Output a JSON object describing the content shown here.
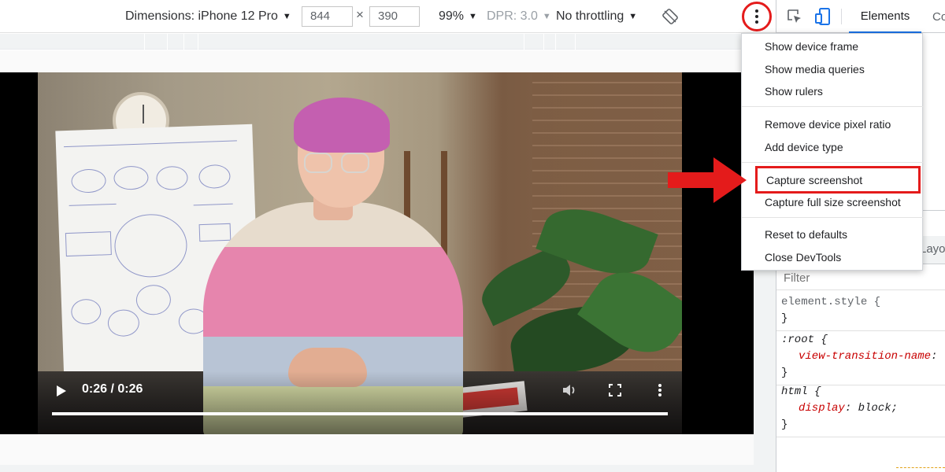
{
  "device_toolbar": {
    "dimensions_label": "Dimensions: iPhone 12 Pro",
    "width_value": "844",
    "height_value": "390",
    "times": "×",
    "zoom": "99%",
    "dpr": "DPR: 3.0",
    "throttling": "No throttling"
  },
  "video": {
    "time": "0:26 / 0:26",
    "progress": 1.0
  },
  "devtools": {
    "tab_elements": "Elements",
    "tab_console": "Co",
    "layout_tab": "Layou",
    "filter_placeholder": "Filter",
    "rules": [
      {
        "selector": "element.style {",
        "props": [],
        "close": "}"
      },
      {
        "selector": ":root {",
        "props": [
          {
            "name": "view-transition-name",
            "value": ":"
          }
        ],
        "close": "}"
      },
      {
        "selector": "html {",
        "props": [
          {
            "name": "display",
            "value": "block;"
          }
        ],
        "close": "}"
      }
    ]
  },
  "menu": {
    "items": [
      "Show device frame",
      "Show media queries",
      "Show rulers",
      "Remove device pixel ratio",
      "Add device type",
      "Capture screenshot",
      "Capture full size screenshot",
      "Reset to defaults",
      "Close DevTools"
    ]
  },
  "colors": {
    "annotation_red": "#e41b1b",
    "active_tab_underline": "#1a73e8",
    "css_property": "#c80000"
  },
  "icons": {
    "rotate": "rotate-icon",
    "more": "more-vertical-icon",
    "inspect": "inspect-element-icon",
    "device_toggle": "device-toolbar-icon",
    "play": "play-icon",
    "mute": "volume-icon",
    "fullscreen": "fullscreen-icon"
  }
}
